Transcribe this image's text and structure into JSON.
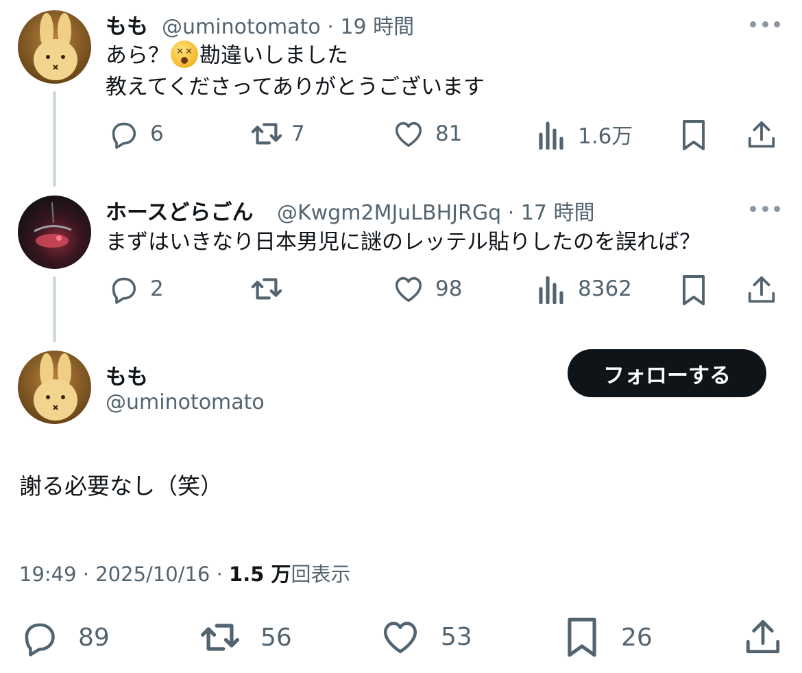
{
  "reply1": {
    "name": "もも",
    "handle": "@uminotomato",
    "separator": "·",
    "time": "19 時間",
    "line1_before": "あら？",
    "emoji": "dizzy-face-emoji",
    "line1_after": "勘違いしました",
    "line2": "教えてくださってありがとうございます",
    "replies": "6",
    "reposts": "7",
    "likes": "81",
    "views": "1.6万"
  },
  "reply2": {
    "name": "ホースどらごん",
    "handle": "@Kwgm2MJuLBHJRGq",
    "separator": "·",
    "time": "17 時間",
    "text": "まずはいきなり日本男児に謎のレッテル貼りしたのを誤れば？",
    "replies": "2",
    "likes": "98",
    "views": "8362"
  },
  "main": {
    "name": "もも",
    "handle": "@uminotomato",
    "follow_label": "フォローする",
    "text": "謝る必要なし（笑）",
    "timestamp": "19:49 · 2025/10/16 ·",
    "view_count": "1.5 万",
    "view_suffix": "回表示",
    "replies": "89",
    "reposts": "56",
    "likes": "53",
    "bookmarks": "26"
  },
  "colors": {
    "text": "#0f1419",
    "muted": "#536471",
    "thread_line": "#cfd9de",
    "follow_bg": "#0f1419"
  }
}
